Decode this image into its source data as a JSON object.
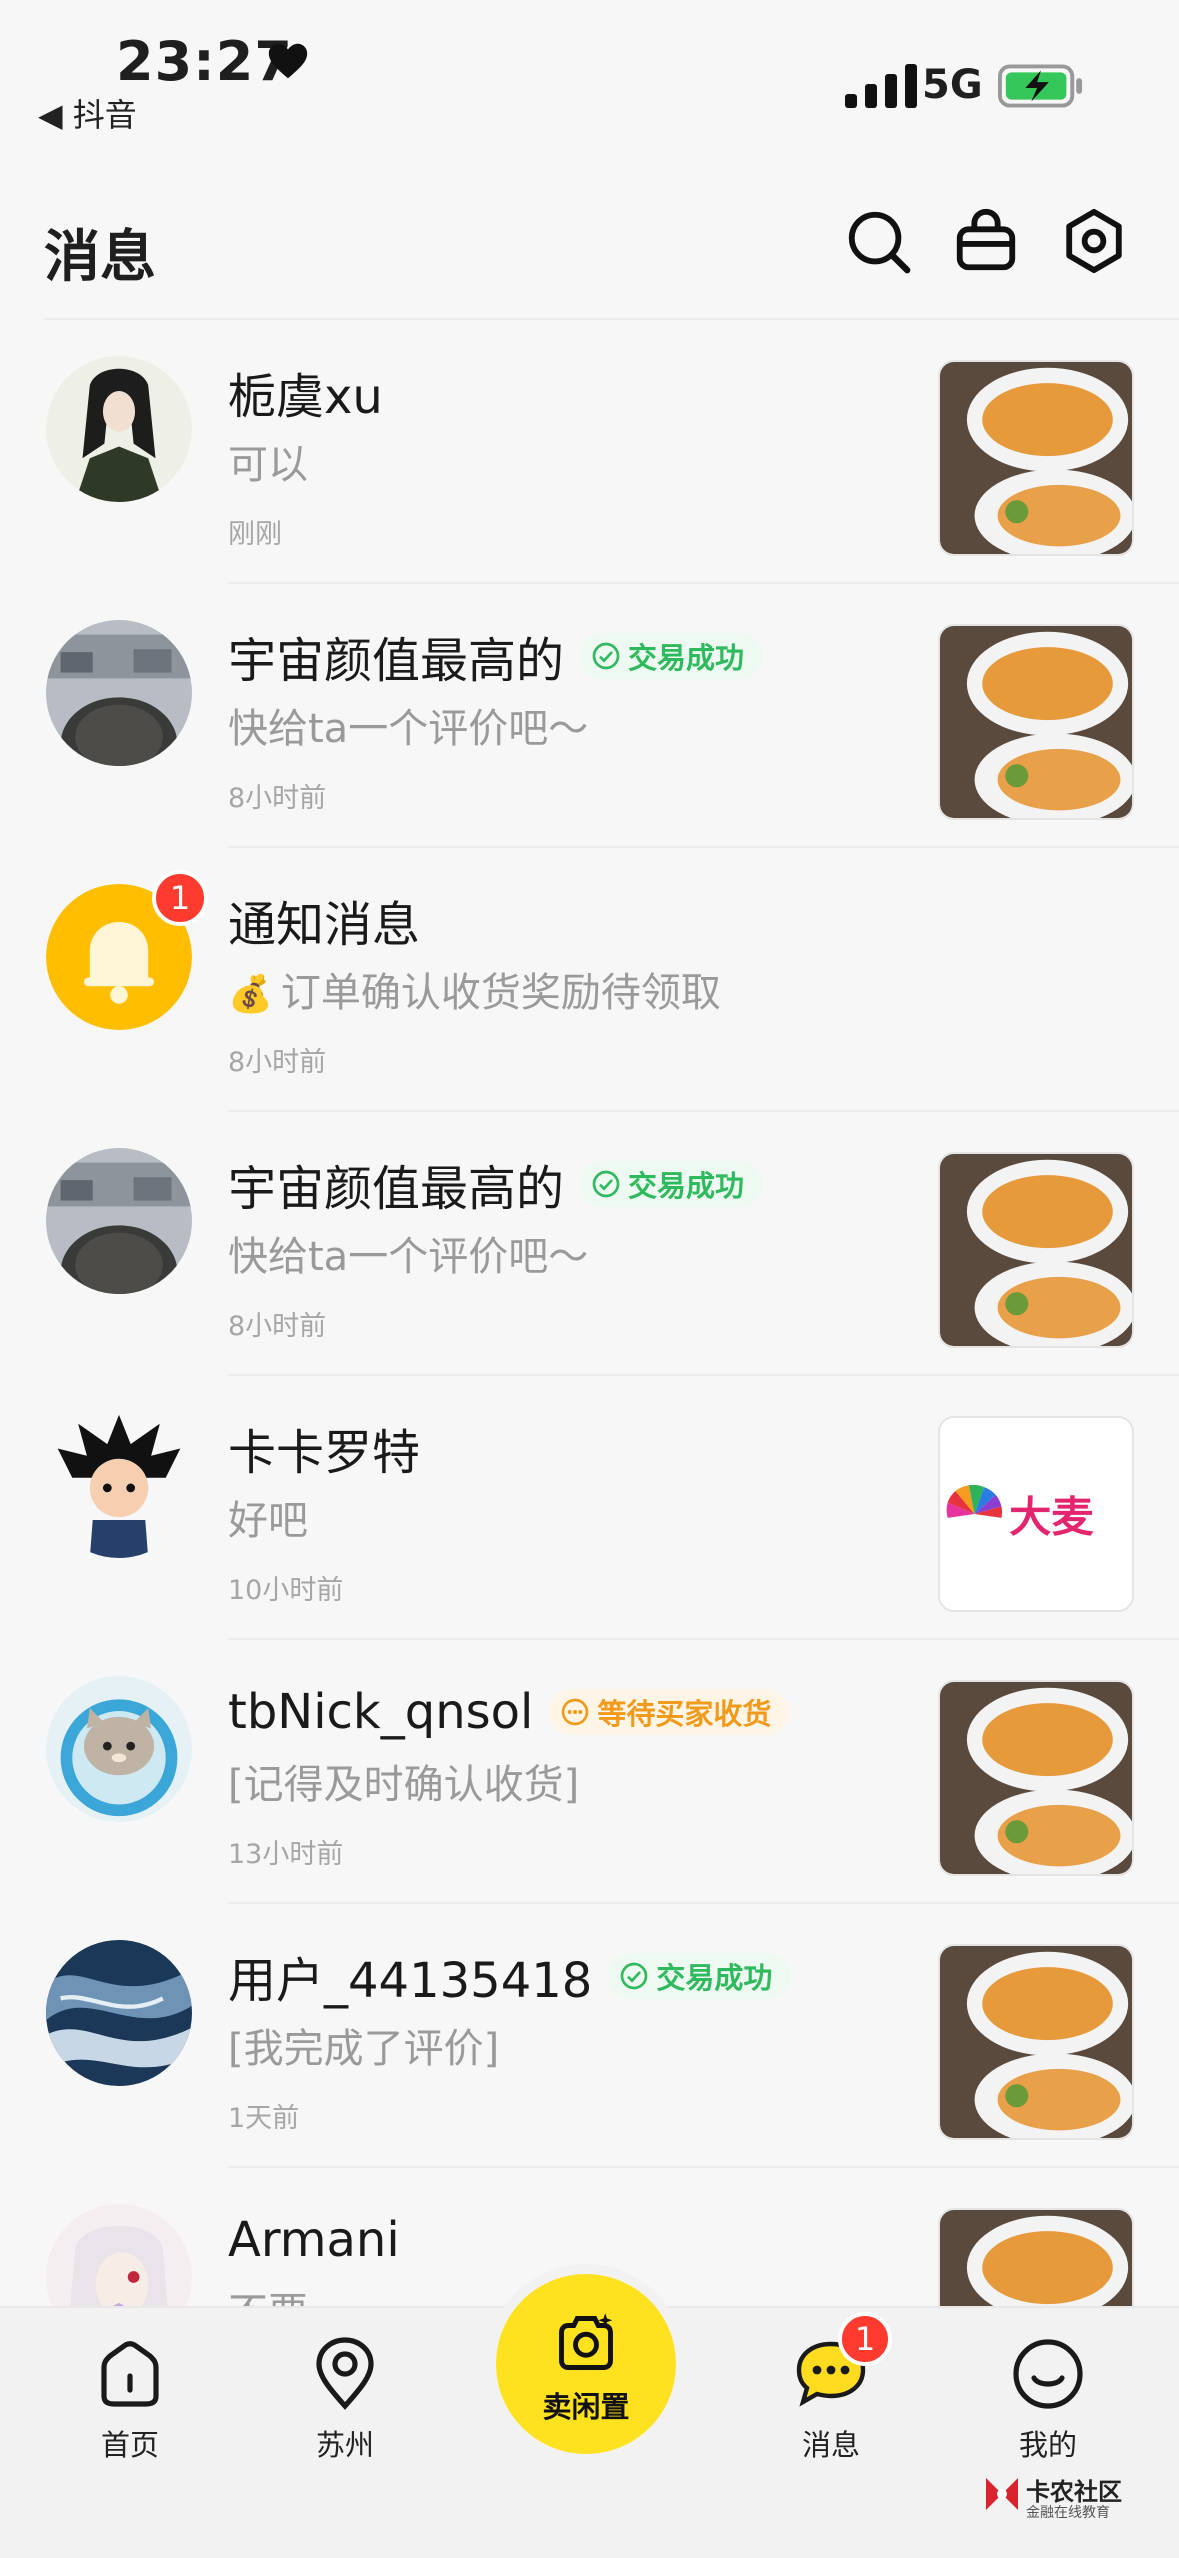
{
  "status_bar": {
    "time": "23:27",
    "back_app": "◀ 抖音",
    "network": "5G"
  },
  "header": {
    "title": "消息"
  },
  "conversations": [
    {
      "name": "栀虞xu",
      "preview": "可以",
      "time": "刚刚",
      "tag": "",
      "avatar": "girl-avatar",
      "thumb": "food-bowls"
    },
    {
      "name": "宇宙颜值最高的",
      "preview": "快给ta一个评价吧～",
      "time": "8小时前",
      "tag": "交易成功",
      "tag_type": "success",
      "avatar": "street-photo-avatar",
      "thumb": "food-bowls"
    },
    {
      "name": "通知消息",
      "preview": "订单确认收货奖励待领取",
      "preview_icon": "💰",
      "time": "8小时前",
      "tag": "",
      "badge": "1",
      "avatar": "bell-avatar"
    },
    {
      "name": "宇宙颜值最高的",
      "preview": "快给ta一个评价吧～",
      "time": "8小时前",
      "tag": "交易成功",
      "tag_type": "success",
      "avatar": "street-photo-avatar",
      "thumb": "food-bowls"
    },
    {
      "name": "卡卡罗特",
      "preview": "好吧",
      "time": "10小时前",
      "tag": "",
      "avatar": "cartoon-boy-avatar",
      "thumb": "damai-logo",
      "thumb_text": "大麦"
    },
    {
      "name": "tbNick_qnsol",
      "preview": "[记得及时确认收货]",
      "time": "13小时前",
      "tag": "等待买家收货",
      "tag_type": "pending",
      "avatar": "cat-avatar",
      "thumb": "food-bowls"
    },
    {
      "name": "用户_44135418",
      "preview": "[我完成了评价]",
      "time": "1天前",
      "tag": "交易成功",
      "tag_type": "success",
      "avatar": "ocean-avatar",
      "thumb": "food-bowls"
    },
    {
      "name": "Armani",
      "preview": "不要",
      "time": "",
      "tag": "",
      "avatar": "anime-girl-avatar",
      "thumb": "food-bowls"
    }
  ],
  "tabbar": {
    "home": "首页",
    "city": "苏州",
    "sell": "卖闲置",
    "messages": "消息",
    "messages_badge": "1",
    "me": "我的"
  },
  "watermark": {
    "title": "卡农社区",
    "subtitle": "金融在线教育"
  },
  "colors": {
    "accent_yellow": "#ffe21f",
    "badge_red": "#ff3b30",
    "success_green": "#2fba5e",
    "pending_orange": "#f29a1b"
  }
}
